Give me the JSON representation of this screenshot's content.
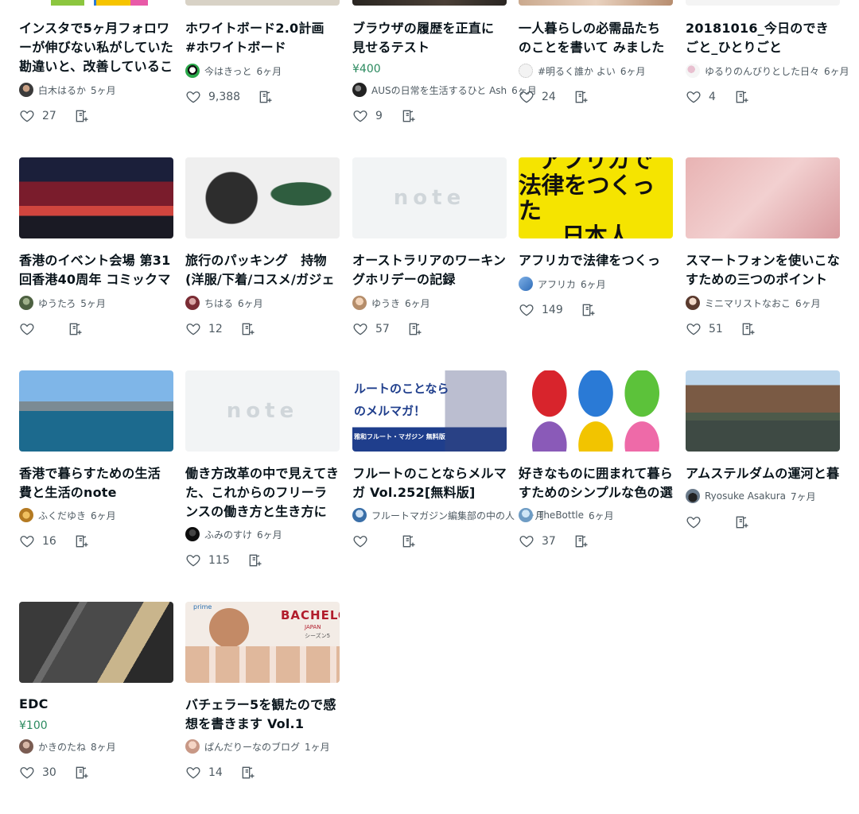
{
  "cards": [
    {
      "title": "インスタで5ヶ月フォロワーが伸びない私がしていた勘違いと、改善していること",
      "author": "白木はるか",
      "time": "5ヶ月",
      "likes": "27"
    },
    {
      "title": "ホワイトボード2.0計画 #ホワイトボード",
      "author": "今はきっと",
      "time": "6ヶ月",
      "likes": "9,388"
    },
    {
      "title": "ブラウザの履歴を正直に見せるテスト",
      "price": "¥400",
      "author": "AUSの日常を生活するひと Ash",
      "time": "6ヶ月",
      "likes": "9"
    },
    {
      "title": "一人暮らしの必需品たちのことを書いて みました　ゆるめの日記",
      "author": "#明るく誰か よい",
      "time": "6ヶ月",
      "likes": "24"
    },
    {
      "title": "20181016_今日のできごと_ひとりごと",
      "author": "ゆるりのんびりとした日々",
      "time": "6ヶ月",
      "likes": "4"
    },
    {
      "title": "香港のイベント会場 第31回香港40周年 コミックマーケット参加レポ",
      "author": "ゆうたろ",
      "time": "5ヶ月",
      "likes": ""
    },
    {
      "title": "旅行のパッキング　持物(洋服/下着/コスメ/ガジェット類)",
      "author": "ちはる",
      "time": "6ヶ月",
      "likes": "12"
    },
    {
      "title": "オーストラリアのワーキングホリデーの記録",
      "author": "ゆうき",
      "time": "6ヶ月",
      "likes": "57"
    },
    {
      "title": "アフリカで法律をつくった日本人",
      "author": "アフリカ",
      "time": "6ヶ月",
      "likes": "149",
      "thumb_text": [
        "アフリカで",
        "法律をつくった",
        "日本人"
      ]
    },
    {
      "title": "スマートフォンを使いこなすための三つのポイントを紹介します",
      "author": "ミニマリストなおこ",
      "time": "6ヶ月",
      "likes": "51"
    },
    {
      "title": "香港で暮らすための生活費と生活のnote",
      "author": "ふくだゆき",
      "time": "6ヶ月",
      "likes": "16"
    },
    {
      "title": "働き方改革の中で見えてきた、これからのフリーランスの働き方と生き方について考える",
      "author": "ふみのすけ",
      "time": "6ヶ月",
      "likes": "115"
    },
    {
      "title": "フルートのことならメルマガ Vol.252[無料版]",
      "author": "フルートマガジン編集部の中の人",
      "time": "6ヶ月",
      "likes": "",
      "thumb_text": [
        "ルートのことなら",
        "のメルマガ！",
        "雅和フルート・マガジン 無料版"
      ]
    },
    {
      "title": "好きなものに囲まれて暮らすためのシンプルな色の選び方",
      "author": "TheBottle",
      "time": "6ヶ月",
      "likes": "37"
    },
    {
      "title": "アムステルダムの運河と暮らし",
      "author": "Ryosuke Asakura",
      "time": "7ヶ月",
      "likes": ""
    },
    {
      "title": "EDC",
      "price": "¥100",
      "author": "かきのたね",
      "time": "8ヶ月",
      "likes": "30"
    },
    {
      "title": "バチェラー5を観たので感想を書きます Vol.1",
      "author": "ぱんだりーなのブログ",
      "time": "1ヶ月",
      "likes": "14",
      "thumb_text": [
        "prime",
        "BACHELOR",
        "JAPAN",
        "シーズン5"
      ]
    }
  ],
  "colors": {
    "price": "#2b8a5f",
    "text": "#08131a",
    "meta": "#4e5a62"
  },
  "icons": {
    "like": "heart-outline-icon",
    "magazine": "magazine-add-icon"
  },
  "note_logo": "note"
}
